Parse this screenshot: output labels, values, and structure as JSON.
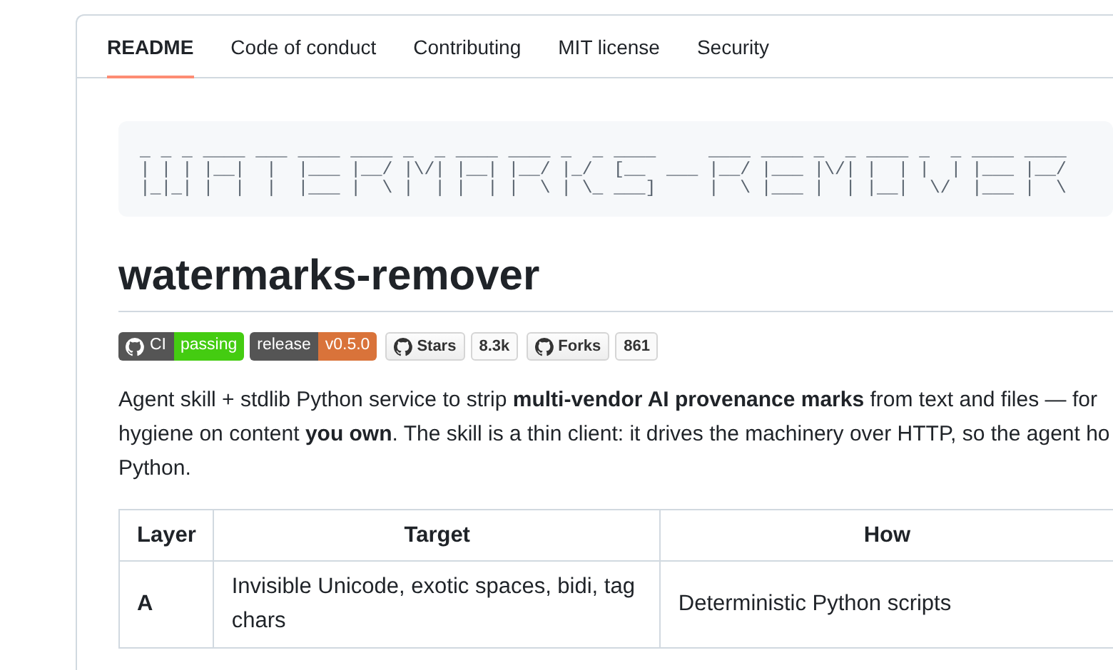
{
  "tabs": [
    {
      "label": "README",
      "selected": true
    },
    {
      "label": "Code of conduct",
      "selected": false
    },
    {
      "label": "Contributing",
      "selected": false
    },
    {
      "label": "MIT license",
      "selected": false
    },
    {
      "label": "Security",
      "selected": false
    }
  ],
  "readme": {
    "banner_lines": [
      "_ _ _ ____ ___ ____ ____ _  _ ____ ____ _  _ ____     ____ ____ _  _ ____ _  _ ____ ____",
      "| | | |__|  |  |___ |__/ |\\/| |__| |__/ |_/  [__  ___ |__/ |___ |\\/| |  | |  | |___ |__/",
      "|_|_| |  |  |  |___ |  \\ |  | |  | |  \\ | \\_ ___]     |  \\ |___ |  | |__|  \\/  |___ |  \\"
    ],
    "title": "watermarks-remover",
    "badges": [
      {
        "kind": "flat-logo",
        "label": "CI",
        "message": "passing",
        "color": "#4c1"
      },
      {
        "kind": "flat",
        "label": "release",
        "message": "v0.5.0",
        "color": "#d9733a"
      },
      {
        "kind": "social",
        "label": "Stars",
        "count": "8.3k"
      },
      {
        "kind": "social",
        "label": "Forks",
        "count": "861"
      }
    ],
    "intro_lines": [
      "Agent skill + stdlib Python service to strip **multi-vendor AI provenance marks** from text and files — for",
      "hygiene on content **you own**. The skill is a thin client: it drives the machinery over HTTP, so the agent ho",
      "Python."
    ],
    "table": {
      "columns": [
        "Layer",
        "Target",
        "How"
      ],
      "rows": [
        [
          "A",
          "Invisible Unicode, exotic spaces, bidi, tag chars",
          "Deterministic Python scripts"
        ]
      ]
    }
  }
}
